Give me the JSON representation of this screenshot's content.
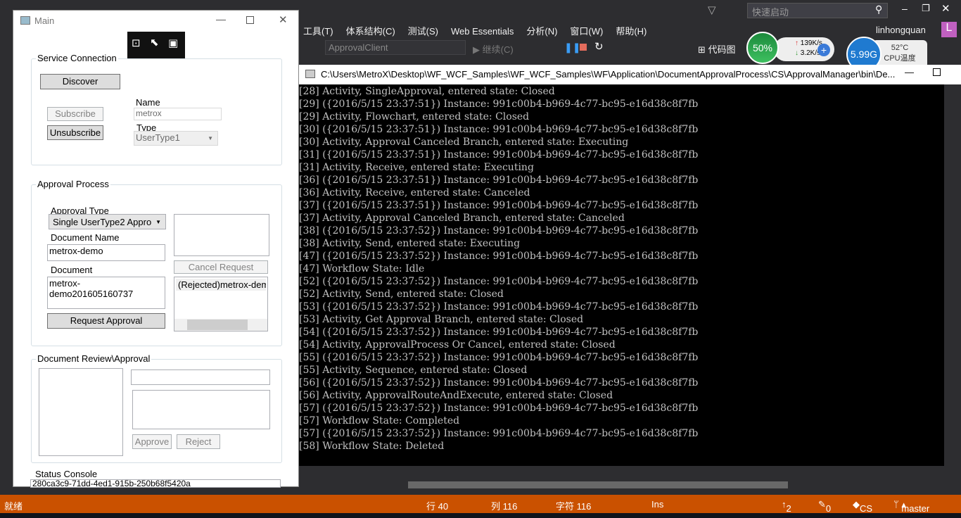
{
  "vs": {
    "menu": [
      "工具(T)",
      "体系结构(C)",
      "测试(S)",
      "Web Essentials",
      "分析(N)",
      "窗口(W)",
      "帮助(H)"
    ],
    "quick_launch_placeholder": "快速启动",
    "user": "linhongquan",
    "user_initial": "L",
    "project_combo": "ApprovalClient",
    "continue_label": "继续(C)",
    "code_map_label": "代码图",
    "monitor": {
      "cpu_percent": "50%",
      "upload": "139K/s",
      "download": "3.2K/s",
      "memory": "5.99G",
      "temp": "52°C",
      "temp_label": "CPU温度"
    },
    "status": {
      "ready": "就绪",
      "line": "行 40",
      "col": "列 116",
      "char": "字符 116",
      "ins": "Ins",
      "up": "2",
      "pencil": "0",
      "repo": "CS",
      "branch": "master"
    },
    "accent": "#ca5100"
  },
  "main": {
    "title": "Main",
    "service": {
      "legend": "Service Connection",
      "discover": "Discover",
      "subscribe": "Subscribe",
      "unsubscribe": "Unsubscribe",
      "name_label": "Name",
      "name_value": "metrox",
      "type_label": "Type",
      "type_value": "UserType1"
    },
    "approval": {
      "legend": "Approval Process",
      "type_label": "Approval Type",
      "type_value": "Single UserType2 Appro",
      "docname_label": "Document Name",
      "docname_value": "metrox-demo",
      "doc_label": "Document",
      "doc_value": "metrox-demo201605160737",
      "request": "Request Approval",
      "cancel": "Cancel Request",
      "list_item": "(Rejected)metrox-dem"
    },
    "review": {
      "legend": "Document Review\\Approval",
      "approve": "Approve",
      "reject": "Reject"
    },
    "status_console": {
      "label": "Status Console",
      "value": "280ca3c9-71dd-4ed1-915b-250b68f5420a"
    }
  },
  "console": {
    "title": "C:\\Users\\MetroX\\Desktop\\WF_WCF_Samples\\WF_WCF_Samples\\WF\\Application\\DocumentApprovalProcess\\CS\\ApprovalManager\\bin\\De...",
    "lines": [
      "[28] Activity, SingleApproval, entered state: Closed",
      "[29] ({2016/5/15 23:37:51}) Instance: 991c00b4-b969-4c77-bc95-e16d38c8f7fb",
      "[29] Activity, Flowchart, entered state: Closed",
      "[30] ({2016/5/15 23:37:51}) Instance: 991c00b4-b969-4c77-bc95-e16d38c8f7fb",
      "[30] Activity, Approval Canceled Branch, entered state: Executing",
      "[31] ({2016/5/15 23:37:51}) Instance: 991c00b4-b969-4c77-bc95-e16d38c8f7fb",
      "[31] Activity, Receive, entered state: Executing",
      "[36] ({2016/5/15 23:37:51}) Instance: 991c00b4-b969-4c77-bc95-e16d38c8f7fb",
      "[36] Activity, Receive, entered state: Canceled",
      "[37] ({2016/5/15 23:37:51}) Instance: 991c00b4-b969-4c77-bc95-e16d38c8f7fb",
      "[37] Activity, Approval Canceled Branch, entered state: Canceled",
      "[38] ({2016/5/15 23:37:52}) Instance: 991c00b4-b969-4c77-bc95-e16d38c8f7fb",
      "[38] Activity, Send, entered state: Executing",
      "[47] ({2016/5/15 23:37:52}) Instance: 991c00b4-b969-4c77-bc95-e16d38c8f7fb",
      "[47] Workflow State: Idle",
      "[52] ({2016/5/15 23:37:52}) Instance: 991c00b4-b969-4c77-bc95-e16d38c8f7fb",
      "[52] Activity, Send, entered state: Closed",
      "[53] ({2016/5/15 23:37:52}) Instance: 991c00b4-b969-4c77-bc95-e16d38c8f7fb",
      "[53] Activity, Get Approval Branch, entered state: Closed",
      "[54] ({2016/5/15 23:37:52}) Instance: 991c00b4-b969-4c77-bc95-e16d38c8f7fb",
      "[54] Activity, ApprovalProcess Or Cancel, entered state: Closed",
      "[55] ({2016/5/15 23:37:52}) Instance: 991c00b4-b969-4c77-bc95-e16d38c8f7fb",
      "[55] Activity, Sequence, entered state: Closed",
      "[56] ({2016/5/15 23:37:52}) Instance: 991c00b4-b969-4c77-bc95-e16d38c8f7fb",
      "[56] Activity, ApprovalRouteAndExecute, entered state: Closed",
      "[57] ({2016/5/15 23:37:52}) Instance: 991c00b4-b969-4c77-bc95-e16d38c8f7fb",
      "[57] Workflow State: Completed",
      "[57] ({2016/5/15 23:37:52}) Instance: 991c00b4-b969-4c77-bc95-e16d38c8f7fb",
      "[58] Workflow State: Deleted"
    ]
  }
}
